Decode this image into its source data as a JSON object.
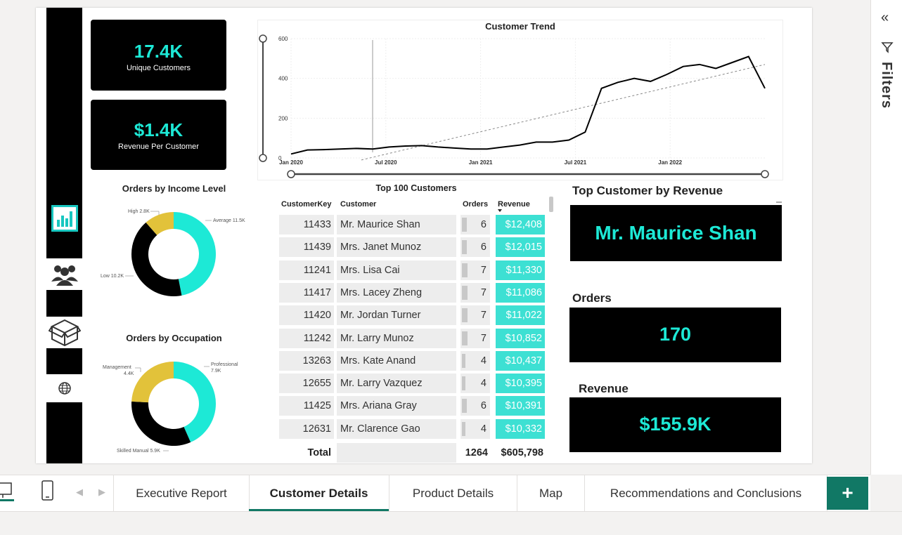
{
  "kpis": [
    {
      "value": "17.4K",
      "label": "Unique Customers"
    },
    {
      "value": "$1.4K",
      "label": "Revenue Per Customer"
    }
  ],
  "sidebar": {
    "icons": [
      "bar-chart-icon",
      "people-icon",
      "box-icon",
      "globe-icon"
    ]
  },
  "income_chart": {
    "title": "Orders by Income Level",
    "labels": {
      "high": "High 2.8K",
      "average": "Average 11.5K",
      "low": "Low 10.2K"
    }
  },
  "occupation_chart": {
    "title": "Orders by Occupation",
    "labels": {
      "management_1": "Management",
      "management_2": "4.4K",
      "professional_1": "Professional",
      "professional_2": "7.9K",
      "skilled": "Skilled Manual 5.9K"
    }
  },
  "trend": {
    "title": "Customer Trend",
    "y_ticks": [
      "600",
      "400",
      "200",
      "0"
    ],
    "x_ticks": [
      "Jan 2020",
      "Jul 2020",
      "Jan 2021",
      "Jul 2021",
      "Jan 2022"
    ]
  },
  "chart_data": [
    {
      "type": "line",
      "title": "Customer Trend",
      "ylim": [
        0,
        600
      ],
      "x": [
        "2020-01",
        "2020-02",
        "2020-03",
        "2020-04",
        "2020-05",
        "2020-06",
        "2020-07",
        "2020-08",
        "2020-09",
        "2020-10",
        "2020-11",
        "2020-12",
        "2021-01",
        "2021-02",
        "2021-03",
        "2021-04",
        "2021-05",
        "2021-06",
        "2021-07",
        "2021-08",
        "2021-09",
        "2021-10",
        "2021-11",
        "2021-12",
        "2022-01",
        "2022-02",
        "2022-03",
        "2022-04",
        "2022-05",
        "2022-06"
      ],
      "series": [
        {
          "values": [
            20,
            40,
            42,
            45,
            48,
            45,
            55,
            60,
            62,
            55,
            50,
            45,
            45,
            55,
            65,
            80,
            80,
            90,
            130,
            350,
            380,
            400,
            385,
            420,
            460,
            470,
            450,
            480,
            510,
            350
          ]
        }
      ],
      "trendline": [
        -10,
        470
      ]
    },
    {
      "type": "pie",
      "title": "Orders by Income Level",
      "categories": [
        "Average",
        "Low",
        "High"
      ],
      "values": [
        11.5,
        10.2,
        2.8
      ],
      "colors": [
        "#1de9d6",
        "#000000",
        "#e2c23a"
      ]
    },
    {
      "type": "pie",
      "title": "Orders by Occupation",
      "categories": [
        "Professional",
        "Skilled Manual",
        "Management"
      ],
      "values": [
        7.9,
        5.9,
        4.4
      ],
      "colors": [
        "#1de9d6",
        "#000000",
        "#e2c23a"
      ]
    }
  ],
  "top100": {
    "title": "Top 100 Customers",
    "headers": {
      "key": "CustomerKey",
      "customer": "Customer",
      "orders": "Orders",
      "revenue": "Revenue"
    },
    "rows": [
      {
        "key": "11433",
        "name": "Mr. Maurice Shan",
        "orders": "6",
        "revenue": "$12,408"
      },
      {
        "key": "11439",
        "name": "Mrs. Janet Munoz",
        "orders": "6",
        "revenue": "$12,015"
      },
      {
        "key": "11241",
        "name": "Mrs. Lisa Cai",
        "orders": "7",
        "revenue": "$11,330"
      },
      {
        "key": "11417",
        "name": "Mrs. Lacey Zheng",
        "orders": "7",
        "revenue": "$11,086"
      },
      {
        "key": "11420",
        "name": "Mr. Jordan Turner",
        "orders": "7",
        "revenue": "$11,022"
      },
      {
        "key": "11242",
        "name": "Mr. Larry Munoz",
        "orders": "7",
        "revenue": "$10,852"
      },
      {
        "key": "13263",
        "name": "Mrs. Kate Anand",
        "orders": "4",
        "revenue": "$10,437"
      },
      {
        "key": "12655",
        "name": "Mr. Larry Vazquez",
        "orders": "4",
        "revenue": "$10,395"
      },
      {
        "key": "11425",
        "name": "Mrs. Ariana Gray",
        "orders": "6",
        "revenue": "$10,391"
      },
      {
        "key": "12631",
        "name": "Mr. Clarence Gao",
        "orders": "4",
        "revenue": "$10,332"
      }
    ],
    "total": {
      "label": "Total",
      "orders": "1264",
      "revenue": "$605,798"
    }
  },
  "top_customer": {
    "title": "Top Customer by Revenue",
    "name": "Mr. Maurice Shan",
    "orders_label": "Orders",
    "orders": "170",
    "revenue_label": "Revenue",
    "revenue": "$155.9K"
  },
  "tabs": [
    "Executive Report",
    "Customer Details",
    "Product Details",
    "Map",
    "Recommendations and Conclusions"
  ],
  "active_tab": "Customer Details",
  "add_page": "+",
  "filters": {
    "label": "Filters"
  },
  "colors": {
    "accent": "#1de9d6",
    "teal_bar": "#3de0d3",
    "gold": "#e2c23a",
    "tab_underline": "#117865"
  }
}
